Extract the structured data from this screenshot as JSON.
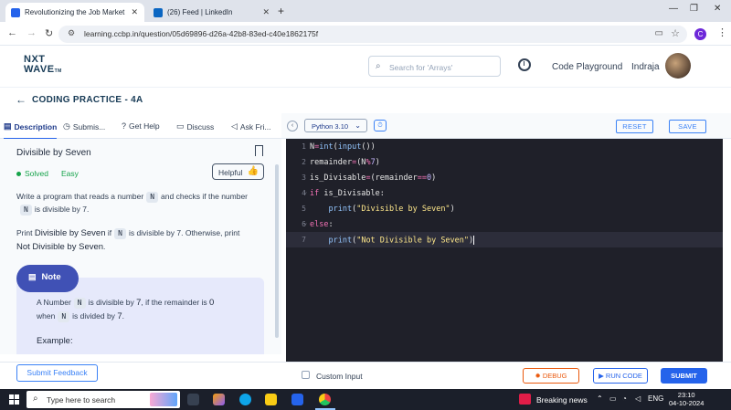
{
  "browser": {
    "tabs": [
      {
        "title": "Revolutionizing the Job Market",
        "active": true
      },
      {
        "title": "(26) Feed | LinkedIn",
        "active": false
      }
    ],
    "url": "learning.ccbp.in/question/05d69896-d26a-42b8-83ed-c40e1862175f",
    "profile_initial": "C"
  },
  "header": {
    "logo_line1": "NXT",
    "logo_line2": "WAVE",
    "logo_tm": "TM",
    "search_placeholder": "Search for 'Arrays'",
    "code_playground": "Code Playground",
    "user_name": "Indraja"
  },
  "breadcrumb": {
    "title": "CODING PRACTICE - 4A"
  },
  "left_tabs": [
    {
      "label": "Description",
      "icon": "file-icon",
      "active": true
    },
    {
      "label": "Submis...",
      "icon": "clock-icon",
      "active": false
    },
    {
      "label": "Get Help",
      "icon": "help-icon",
      "active": false
    },
    {
      "label": "Discuss",
      "icon": "chat-icon",
      "active": false
    },
    {
      "label": "Ask Fri...",
      "icon": "megaphone-icon",
      "active": false
    }
  ],
  "problem": {
    "title": "Divisible by Seven",
    "status": "Solved",
    "difficulty": "Easy",
    "helpful_label": "Helpful",
    "p1_a": "Write a program that reads a number",
    "p1_var": "N",
    "p1_b": "and checks if the number",
    "p1_var2": "N",
    "p1_c": "is divisible by 7.",
    "p2_a": "Print",
    "p2_bold1": "Divisible by Seven",
    "p2_b": "if",
    "p2_var": "N",
    "p2_c": "is divisible by 7. Otherwise, print",
    "p2_bold2": "Not Divisible by Seven",
    "p2_d": ".",
    "note_label": "Note",
    "note_a": "A Number",
    "note_var": "N",
    "note_b": "is divisible by",
    "note_num": "7",
    "note_c": ", if the remainder is",
    "note_zero": "0",
    "note_d": "when",
    "note_var2": "N",
    "note_e": "is divided by",
    "note_num2": "7",
    "note_f": ".",
    "example_label": "Example:"
  },
  "editor": {
    "language": "Python 3.10",
    "reset_label": "RESET",
    "save_label": "SAVE",
    "line_numbers": [
      "1",
      "2",
      "3",
      "4",
      "5",
      "6",
      "7"
    ],
    "active_line": 7
  },
  "footer": {
    "feedback_label": "Submit Feedback",
    "custom_input_label": "Custom Input",
    "debug_label": "DEBUG",
    "run_label": "RUN CODE",
    "submit_label": "SUBMIT"
  },
  "taskbar": {
    "search_placeholder": "Type here to search",
    "news": "Breaking news",
    "lang": "ENG",
    "time": "23:10",
    "date": "04-10-2024"
  },
  "colors": {
    "accent": "#2563eb",
    "brand": "#183b56",
    "note_pill": "#4051b5",
    "editor_bg": "#1f2029",
    "debug": "#ea580c"
  }
}
